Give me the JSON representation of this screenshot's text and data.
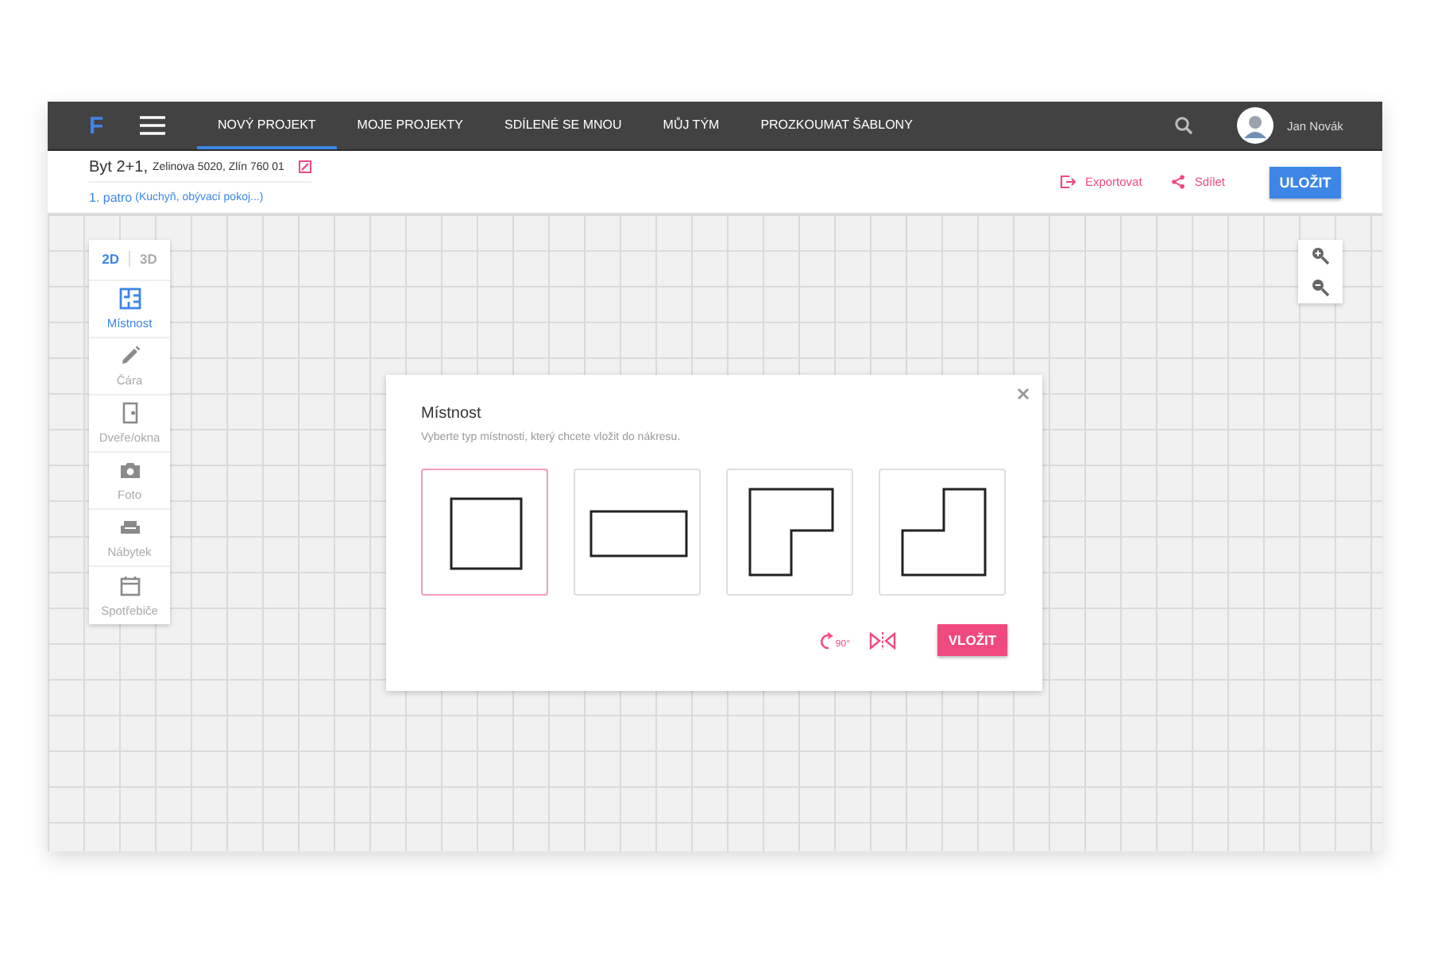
{
  "topbar": {
    "logo": "F",
    "nav": [
      {
        "label": "NOVÝ PROJEKT",
        "selected": true
      },
      {
        "label": "MOJE PROJEKTY",
        "selected": false
      },
      {
        "label": "SDÍLENÉ SE MNOU",
        "selected": false
      },
      {
        "label": "MŮJ TÝM",
        "selected": false
      },
      {
        "label": "PROZKOUMAT ŠABLONY",
        "selected": false
      }
    ],
    "user": "Jan Novák"
  },
  "project": {
    "title": "Byt 2+1,",
    "address": "Zelinova 5020, Zlín 760 01",
    "floor": "1. patro",
    "rooms": "(Kuchyň, obývací pokoj...)",
    "export": "Exportovat",
    "share": "Sdílet",
    "save": "ULOŽIT"
  },
  "view_modes": [
    {
      "label": "2D",
      "selected": true
    },
    {
      "label": "3D",
      "selected": false
    }
  ],
  "tools": [
    {
      "kind": "room",
      "label": "Místnost",
      "selected": true
    },
    {
      "kind": "line",
      "label": "Čára",
      "selected": false
    },
    {
      "kind": "door",
      "label": "Dveře/okna",
      "selected": false
    },
    {
      "kind": "photo",
      "label": "Foto",
      "selected": false
    },
    {
      "kind": "furniture",
      "label": "Nábytek",
      "selected": false
    },
    {
      "kind": "appliance",
      "label": "Spotřebiče",
      "selected": false
    }
  ],
  "dialog": {
    "title": "Místnost",
    "subtitle": "Vyberte typ místnosti, který chcete vložit do nákresu.",
    "shapes": [
      {
        "kind": "square",
        "selected": true
      },
      {
        "kind": "rectangle",
        "selected": false
      },
      {
        "kind": "l-shape",
        "selected": false
      },
      {
        "kind": "l-shape-mirrored",
        "selected": false
      }
    ],
    "rotate_label": "90°",
    "insert": "VLOŽIT"
  }
}
